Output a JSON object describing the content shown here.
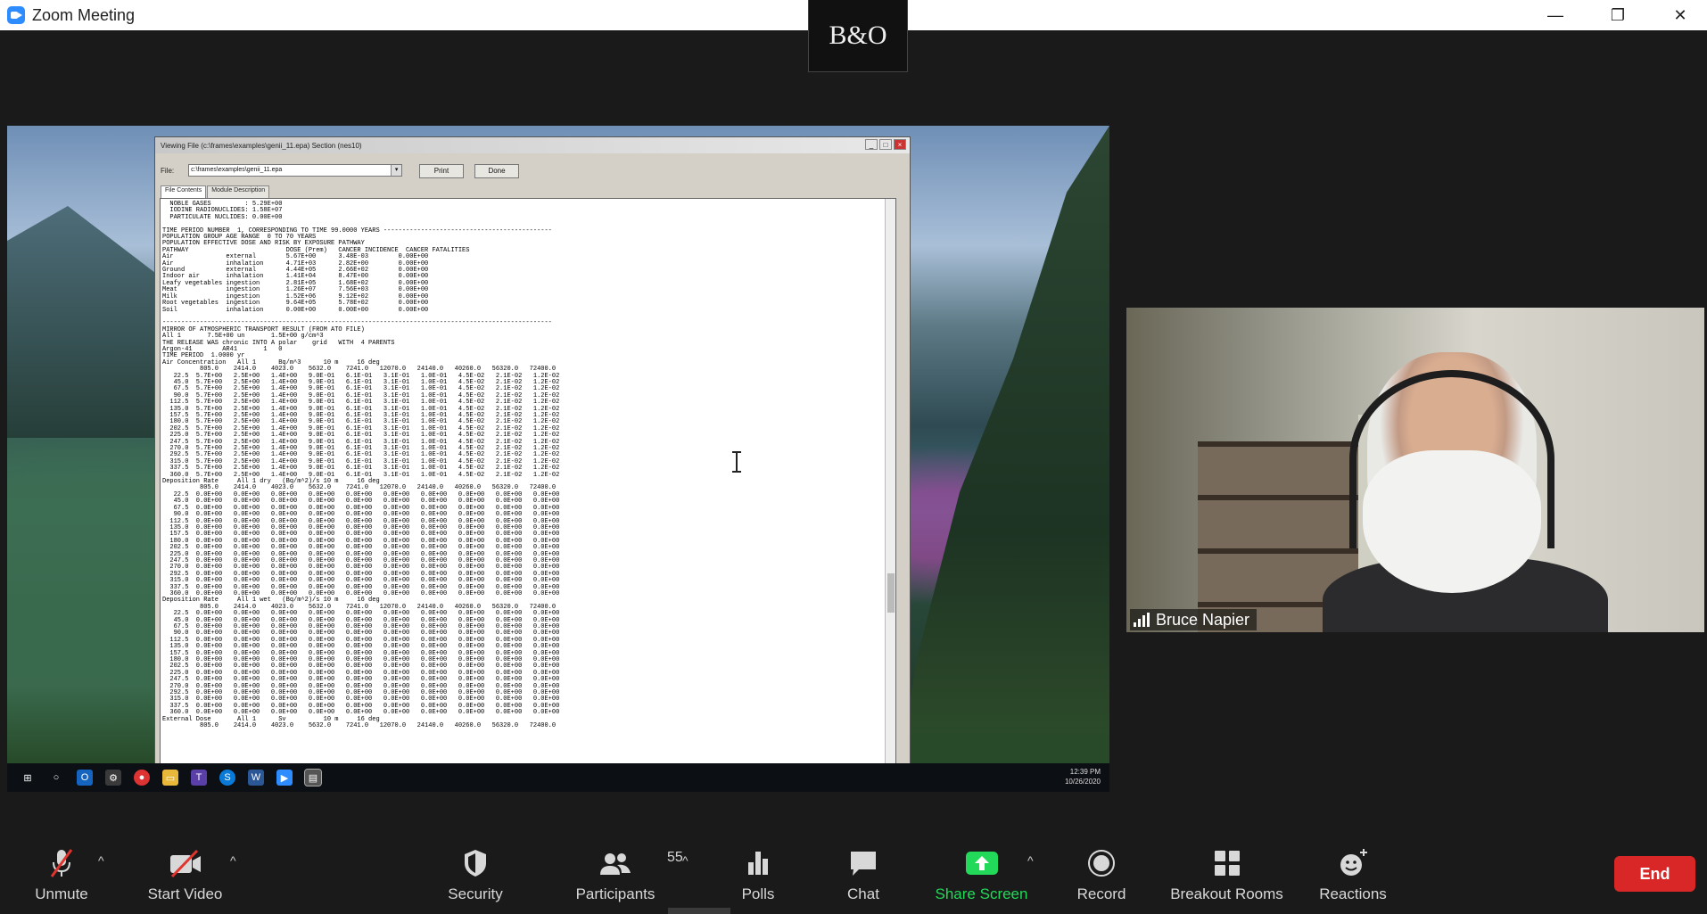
{
  "window": {
    "title": "Zoom Meeting",
    "minimize": "—",
    "restore": "❐",
    "close": "✕"
  },
  "logo": {
    "text": "B&O"
  },
  "viewer": {
    "title": "Viewing File (c:\\frames\\examples\\genii_11.epa) Section (nes10)",
    "file_label": "File:",
    "file_value": "c:\\frames\\examples\\genii_11.epa",
    "print": "Print",
    "done": "Done",
    "tabs": [
      "File Contents",
      "Module Description"
    ],
    "content_lines": [
      "  NOBLE GASES         : 5.29E+00",
      "  IODINE RADIONUCLIDES: 1.58E+07",
      "  PARTICULATE NUCLIDES: 0.00E+00",
      "",
      "TIME PERIOD NUMBER  1, CORRESPONDING TO TIME 99.0000 YEARS ---------------------------------------------",
      "POPULATION GROUP AGE RANGE  0 TO 70 YEARS",
      "POPULATION EFFECTIVE DOSE AND RISK BY EXPOSURE PATHWAY",
      "PATHWAY                          DOSE (Prem)   CANCER INCIDENCE  CANCER FATALITIES",
      "Air              external        5.67E+00      3.48E-03        0.00E+00",
      "Air              inhalation      4.71E+03      2.82E+00        0.00E+00",
      "Ground           external        4.44E+05      2.66E+02        0.00E+00",
      "Indoor air       inhalation      1.41E+04      8.47E+00        0.00E+00",
      "Leafy vegetables ingestion       2.81E+05      1.68E+02        0.00E+00",
      "Meat             ingestion       1.26E+07      7.56E+03        0.00E+00",
      "Milk             ingestion       1.52E+06      9.12E+02        0.00E+00",
      "Root vegetables  ingestion       9.64E+05      5.78E+02        0.00E+00",
      "Soil             inhalation      0.00E+00      0.00E+00        0.00E+00",
      "",
      "--------------------------------------------------------------------------------------------------------",
      "MIRROR OF ATMOSPHERIC TRANSPORT RESULT (FROM ATO FILE)",
      "All 1       7.5E+00 un       1.5E+00 g/cm^3",
      "THE RELEASE WAS chronic INTO A polar    grid   WITH  4 PARENTS",
      "Argon-41        AR41       1   0",
      "TIME PERIOD  1.0000 yr",
      "Air Concentration   All 1      Bq/m^3      10 m     16 deg",
      "          805.0    2414.0    4023.0    5632.0    7241.0   12070.0   24140.0   40260.0   56320.0   72400.0",
      "   22.5  5.7E+00   2.5E+00   1.4E+00   9.0E-01   6.1E-01   3.1E-01   1.0E-01   4.5E-02   2.1E-02   1.2E-02",
      "   45.0  5.7E+00   2.5E+00   1.4E+00   9.0E-01   6.1E-01   3.1E-01   1.0E-01   4.5E-02   2.1E-02   1.2E-02",
      "   67.5  5.7E+00   2.5E+00   1.4E+00   9.0E-01   6.1E-01   3.1E-01   1.0E-01   4.5E-02   2.1E-02   1.2E-02",
      "   90.0  5.7E+00   2.5E+00   1.4E+00   9.0E-01   6.1E-01   3.1E-01   1.0E-01   4.5E-02   2.1E-02   1.2E-02",
      "  112.5  5.7E+00   2.5E+00   1.4E+00   9.0E-01   6.1E-01   3.1E-01   1.0E-01   4.5E-02   2.1E-02   1.2E-02",
      "  135.0  5.7E+00   2.5E+00   1.4E+00   9.0E-01   6.1E-01   3.1E-01   1.0E-01   4.5E-02   2.1E-02   1.2E-02",
      "  157.5  5.7E+00   2.5E+00   1.4E+00   9.0E-01   6.1E-01   3.1E-01   1.0E-01   4.5E-02   2.1E-02   1.2E-02",
      "  180.0  5.7E+00   2.5E+00   1.4E+00   9.0E-01   6.1E-01   3.1E-01   1.0E-01   4.5E-02   2.1E-02   1.2E-02",
      "  202.5  5.7E+00   2.5E+00   1.4E+00   9.0E-01   6.1E-01   3.1E-01   1.0E-01   4.5E-02   2.1E-02   1.2E-02",
      "  225.0  5.7E+00   2.5E+00   1.4E+00   9.0E-01   6.1E-01   3.1E-01   1.0E-01   4.5E-02   2.1E-02   1.2E-02",
      "  247.5  5.7E+00   2.5E+00   1.4E+00   9.0E-01   6.1E-01   3.1E-01   1.0E-01   4.5E-02   2.1E-02   1.2E-02",
      "  270.0  5.7E+00   2.5E+00   1.4E+00   9.0E-01   6.1E-01   3.1E-01   1.0E-01   4.5E-02   2.1E-02   1.2E-02",
      "  292.5  5.7E+00   2.5E+00   1.4E+00   9.0E-01   6.1E-01   3.1E-01   1.0E-01   4.5E-02   2.1E-02   1.2E-02",
      "  315.0  5.7E+00   2.5E+00   1.4E+00   9.0E-01   6.1E-01   3.1E-01   1.0E-01   4.5E-02   2.1E-02   1.2E-02",
      "  337.5  5.7E+00   2.5E+00   1.4E+00   9.0E-01   6.1E-01   3.1E-01   1.0E-01   4.5E-02   2.1E-02   1.2E-02",
      "  360.0  5.7E+00   2.5E+00   1.4E+00   9.0E-01   6.1E-01   3.1E-01   1.0E-01   4.5E-02   2.1E-02   1.2E-02",
      "Deposition Rate     All 1 dry   (Bq/m^2)/s 10 m     16 deg",
      "          805.0    2414.0    4023.0    5632.0    7241.0   12070.0   24140.0   40260.0   56320.0   72400.0",
      "   22.5  0.0E+00   0.0E+00   0.0E+00   0.0E+00   0.0E+00   0.0E+00   0.0E+00   0.0E+00   0.0E+00   0.0E+00",
      "   45.0  0.0E+00   0.0E+00   0.0E+00   0.0E+00   0.0E+00   0.0E+00   0.0E+00   0.0E+00   0.0E+00   0.0E+00",
      "   67.5  0.0E+00   0.0E+00   0.0E+00   0.0E+00   0.0E+00   0.0E+00   0.0E+00   0.0E+00   0.0E+00   0.0E+00",
      "   90.0  0.0E+00   0.0E+00   0.0E+00   0.0E+00   0.0E+00   0.0E+00   0.0E+00   0.0E+00   0.0E+00   0.0E+00",
      "  112.5  0.0E+00   0.0E+00   0.0E+00   0.0E+00   0.0E+00   0.0E+00   0.0E+00   0.0E+00   0.0E+00   0.0E+00",
      "  135.0  0.0E+00   0.0E+00   0.0E+00   0.0E+00   0.0E+00   0.0E+00   0.0E+00   0.0E+00   0.0E+00   0.0E+00",
      "  157.5  0.0E+00   0.0E+00   0.0E+00   0.0E+00   0.0E+00   0.0E+00   0.0E+00   0.0E+00   0.0E+00   0.0E+00",
      "  180.0  0.0E+00   0.0E+00   0.0E+00   0.0E+00   0.0E+00   0.0E+00   0.0E+00   0.0E+00   0.0E+00   0.0E+00",
      "  202.5  0.0E+00   0.0E+00   0.0E+00   0.0E+00   0.0E+00   0.0E+00   0.0E+00   0.0E+00   0.0E+00   0.0E+00",
      "  225.0  0.0E+00   0.0E+00   0.0E+00   0.0E+00   0.0E+00   0.0E+00   0.0E+00   0.0E+00   0.0E+00   0.0E+00",
      "  247.5  0.0E+00   0.0E+00   0.0E+00   0.0E+00   0.0E+00   0.0E+00   0.0E+00   0.0E+00   0.0E+00   0.0E+00",
      "  270.0  0.0E+00   0.0E+00   0.0E+00   0.0E+00   0.0E+00   0.0E+00   0.0E+00   0.0E+00   0.0E+00   0.0E+00",
      "  292.5  0.0E+00   0.0E+00   0.0E+00   0.0E+00   0.0E+00   0.0E+00   0.0E+00   0.0E+00   0.0E+00   0.0E+00",
      "  315.0  0.0E+00   0.0E+00   0.0E+00   0.0E+00   0.0E+00   0.0E+00   0.0E+00   0.0E+00   0.0E+00   0.0E+00",
      "  337.5  0.0E+00   0.0E+00   0.0E+00   0.0E+00   0.0E+00   0.0E+00   0.0E+00   0.0E+00   0.0E+00   0.0E+00",
      "  360.0  0.0E+00   0.0E+00   0.0E+00   0.0E+00   0.0E+00   0.0E+00   0.0E+00   0.0E+00   0.0E+00   0.0E+00",
      "Deposition Rate     All 1 wet   (Bq/m^2)/s 10 m     16 deg",
      "          805.0    2414.0    4023.0    5632.0    7241.0   12070.0   24140.0   40260.0   56320.0   72400.0",
      "   22.5  0.0E+00   0.0E+00   0.0E+00   0.0E+00   0.0E+00   0.0E+00   0.0E+00   0.0E+00   0.0E+00   0.0E+00",
      "   45.0  0.0E+00   0.0E+00   0.0E+00   0.0E+00   0.0E+00   0.0E+00   0.0E+00   0.0E+00   0.0E+00   0.0E+00",
      "   67.5  0.0E+00   0.0E+00   0.0E+00   0.0E+00   0.0E+00   0.0E+00   0.0E+00   0.0E+00   0.0E+00   0.0E+00",
      "   90.0  0.0E+00   0.0E+00   0.0E+00   0.0E+00   0.0E+00   0.0E+00   0.0E+00   0.0E+00   0.0E+00   0.0E+00",
      "  112.5  0.0E+00   0.0E+00   0.0E+00   0.0E+00   0.0E+00   0.0E+00   0.0E+00   0.0E+00   0.0E+00   0.0E+00",
      "  135.0  0.0E+00   0.0E+00   0.0E+00   0.0E+00   0.0E+00   0.0E+00   0.0E+00   0.0E+00   0.0E+00   0.0E+00",
      "  157.5  0.0E+00   0.0E+00   0.0E+00   0.0E+00   0.0E+00   0.0E+00   0.0E+00   0.0E+00   0.0E+00   0.0E+00",
      "  180.0  0.0E+00   0.0E+00   0.0E+00   0.0E+00   0.0E+00   0.0E+00   0.0E+00   0.0E+00   0.0E+00   0.0E+00",
      "  202.5  0.0E+00   0.0E+00   0.0E+00   0.0E+00   0.0E+00   0.0E+00   0.0E+00   0.0E+00   0.0E+00   0.0E+00",
      "  225.0  0.0E+00   0.0E+00   0.0E+00   0.0E+00   0.0E+00   0.0E+00   0.0E+00   0.0E+00   0.0E+00   0.0E+00",
      "  247.5  0.0E+00   0.0E+00   0.0E+00   0.0E+00   0.0E+00   0.0E+00   0.0E+00   0.0E+00   0.0E+00   0.0E+00",
      "  270.0  0.0E+00   0.0E+00   0.0E+00   0.0E+00   0.0E+00   0.0E+00   0.0E+00   0.0E+00   0.0E+00   0.0E+00",
      "  292.5  0.0E+00   0.0E+00   0.0E+00   0.0E+00   0.0E+00   0.0E+00   0.0E+00   0.0E+00   0.0E+00   0.0E+00",
      "  315.0  0.0E+00   0.0E+00   0.0E+00   0.0E+00   0.0E+00   0.0E+00   0.0E+00   0.0E+00   0.0E+00   0.0E+00",
      "  337.5  0.0E+00   0.0E+00   0.0E+00   0.0E+00   0.0E+00   0.0E+00   0.0E+00   0.0E+00   0.0E+00   0.0E+00",
      "  360.0  0.0E+00   0.0E+00   0.0E+00   0.0E+00   0.0E+00   0.0E+00   0.0E+00   0.0E+00   0.0E+00   0.0E+00",
      "External Dose       All 1      Sv          10 m     16 deg",
      "          805.0    2414.0    4023.0    5632.0    7241.0   12070.0   24140.0   40260.0   56320.0   72400.0"
    ]
  },
  "taskbar": {
    "time": "12:39 PM",
    "date": "10/26/2020"
  },
  "participant": {
    "name": "Bruce Napier"
  },
  "toolbar": {
    "unmute": "Unmute",
    "start_video": "Start Video",
    "security": "Security",
    "participants": "Participants",
    "participants_count": "55",
    "polls": "Polls",
    "chat": "Chat",
    "share_screen": "Share Screen",
    "record": "Record",
    "breakout_rooms": "Breakout Rooms",
    "reactions": "Reactions",
    "end": "End",
    "caret": "^"
  },
  "colors": {
    "accent_green": "#23d959",
    "end_red": "#d92727",
    "zoom_blue": "#2d8cff"
  }
}
